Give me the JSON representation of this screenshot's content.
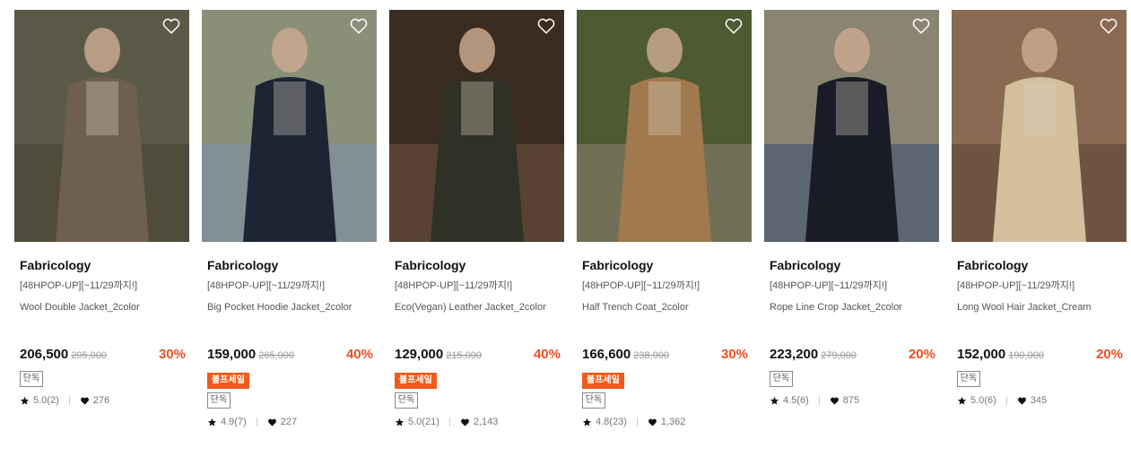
{
  "products": [
    {
      "brand": "Fabricology",
      "promo": "[48HPOP-UP][~11/29까지!]",
      "name": "Wool Double Jacket_2color",
      "price": "206,500",
      "original_price": "295,000",
      "discount": "30%",
      "sale_badge": "",
      "exclusive_badge": "단독",
      "rating": "5.0(2)",
      "likes": "276",
      "photo_colors": [
        "#5b5a48",
        "#6e5f4f",
        "#4a4236"
      ]
    },
    {
      "brand": "Fabricology",
      "promo": "[48HPOP-UP][~11/29까지!]",
      "name": "Big Pocket Hoodie Jacket_2color",
      "price": "159,000",
      "original_price": "265,000",
      "discount": "40%",
      "sale_badge": "볼프세일",
      "exclusive_badge": "단독",
      "rating": "4.9(7)",
      "likes": "227",
      "photo_colors": [
        "#8a9078",
        "#1d2433",
        "#7d90a6"
      ]
    },
    {
      "brand": "Fabricology",
      "promo": "[48HPOP-UP][~11/29까지!]",
      "name": "Eco(Vegan) Leather Jacket_2color",
      "price": "129,000",
      "original_price": "215,000",
      "discount": "40%",
      "sale_badge": "볼프세일",
      "exclusive_badge": "단독",
      "rating": "5.0(21)",
      "likes": "2,143",
      "photo_colors": [
        "#3b2c22",
        "#2f3026",
        "#6b5140"
      ]
    },
    {
      "brand": "Fabricology",
      "promo": "[48HPOP-UP][~11/29까지!]",
      "name": "Half Trench Coat_2color",
      "price": "166,600",
      "original_price": "238,000",
      "discount": "30%",
      "sale_badge": "볼프세일",
      "exclusive_badge": "단독",
      "rating": "4.8(23)",
      "likes": "1,362",
      "photo_colors": [
        "#4d5a32",
        "#a07a4e",
        "#8a7f6e"
      ]
    },
    {
      "brand": "Fabricology",
      "promo": "[48HPOP-UP][~11/29까지!]",
      "name": "Rope Line Crop Jacket_2color",
      "price": "223,200",
      "original_price": "279,000",
      "discount": "20%",
      "sale_badge": "",
      "exclusive_badge": "단독",
      "rating": "4.5(6)",
      "likes": "875",
      "photo_colors": [
        "#8b8472",
        "#191c26",
        "#3c5272"
      ]
    },
    {
      "brand": "Fabricology",
      "promo": "[48HPOP-UP][~11/29까지!]",
      "name": "Long Wool Hair Jacket_Cream",
      "price": "152,000",
      "original_price": "190,000",
      "discount": "20%",
      "sale_badge": "",
      "exclusive_badge": "단독",
      "rating": "5.0(6)",
      "likes": "345",
      "photo_colors": [
        "#8a6a52",
        "#d2bf9c",
        "#5a4536"
      ]
    }
  ],
  "colors": {
    "discount": "#f04e23",
    "sale_badge": "#f05a1a"
  },
  "icons": {
    "wish": "heart-outline-icon",
    "rating": "star-icon",
    "likes": "heart-filled-icon"
  }
}
